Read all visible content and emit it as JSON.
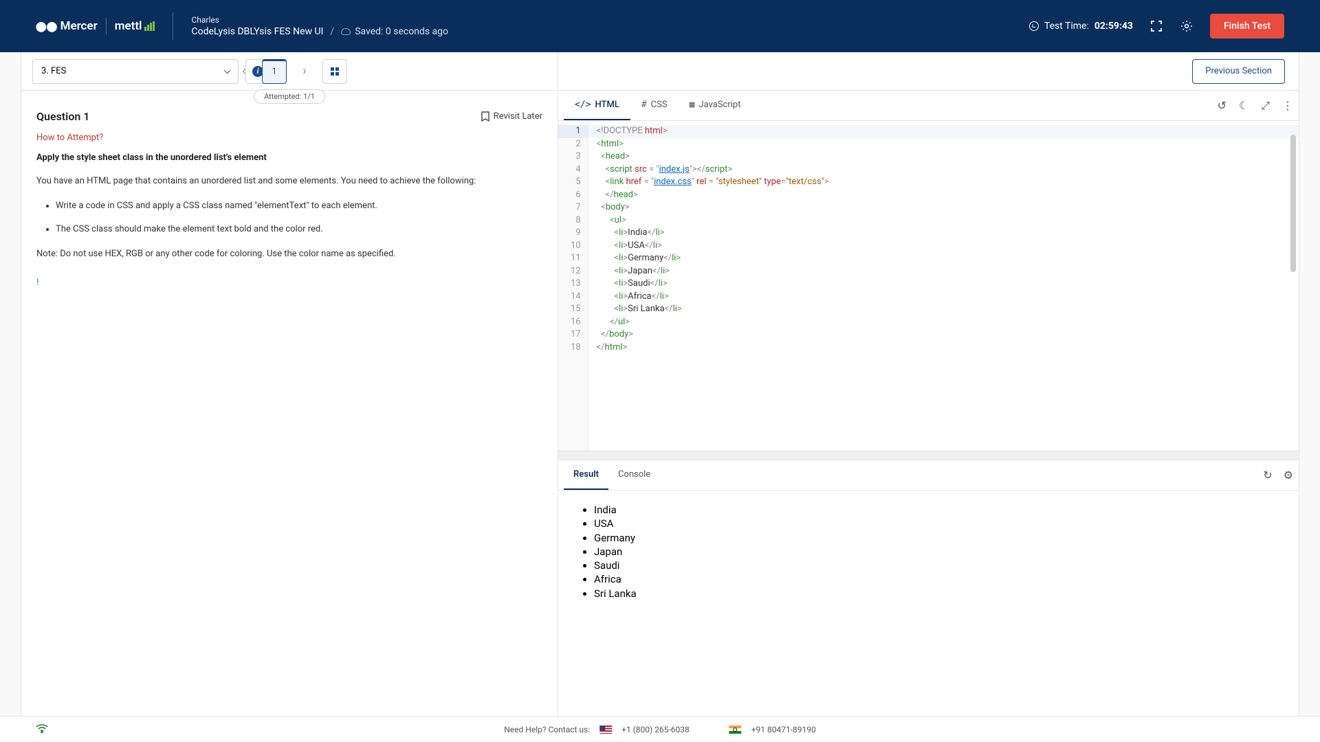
{
  "header": {
    "brand1": "Mercer",
    "brand2": "mettl",
    "userName": "Charles",
    "testTitle": "CodeLysis DBLYsis FES New UI",
    "savedText": "Saved: 0 seconds ago",
    "testTimeLabel": "Test Time:",
    "testTimeValue": "02:59:43",
    "finishLabel": "Finish Test"
  },
  "toolbar": {
    "sectionLabel": "3. FES",
    "pageNum": "1",
    "attempted": "Attempted: 1/1",
    "prevSection": "Previous Section"
  },
  "question": {
    "heading": "Question 1",
    "revisit": "Revisit Later",
    "howLink": "How to Attempt?",
    "title": "Apply the style sheet class in the unordered list's element",
    "intro": "You have an HTML page that contains an unordered list and some elements. You need to achieve the following:",
    "bullets": [
      "Write a code in CSS and apply a CSS class named \"elementText\" to each element.",
      "The CSS class should make the element text bold and the color red."
    ],
    "note": "Note: Do not use HEX, RGB or any other code for coloring. Use the color name as specified.",
    "mark": "!"
  },
  "codeTabs": {
    "html": "HTML",
    "css": "CSS",
    "js": "JavaScript"
  },
  "code": {
    "lineCount": 18,
    "listItems": [
      "India",
      "USA",
      "Germany",
      "Japan",
      "Saudi",
      "Africa",
      "Sri Lanka"
    ],
    "scriptSrc": "index.js",
    "linkHref": "index.css",
    "linkRel": "stylesheet",
    "linkType": "text/css"
  },
  "resultTabs": {
    "result": "Result",
    "console": "Console"
  },
  "resultItems": [
    "India",
    "USA",
    "Germany",
    "Japan",
    "Saudi",
    "Africa",
    "Sri Lanka"
  ],
  "footer": {
    "help": "Need Help? Contact us:",
    "phoneUS": "+1 (800) 265-6038",
    "phoneIN": "+91 80471-89190"
  }
}
